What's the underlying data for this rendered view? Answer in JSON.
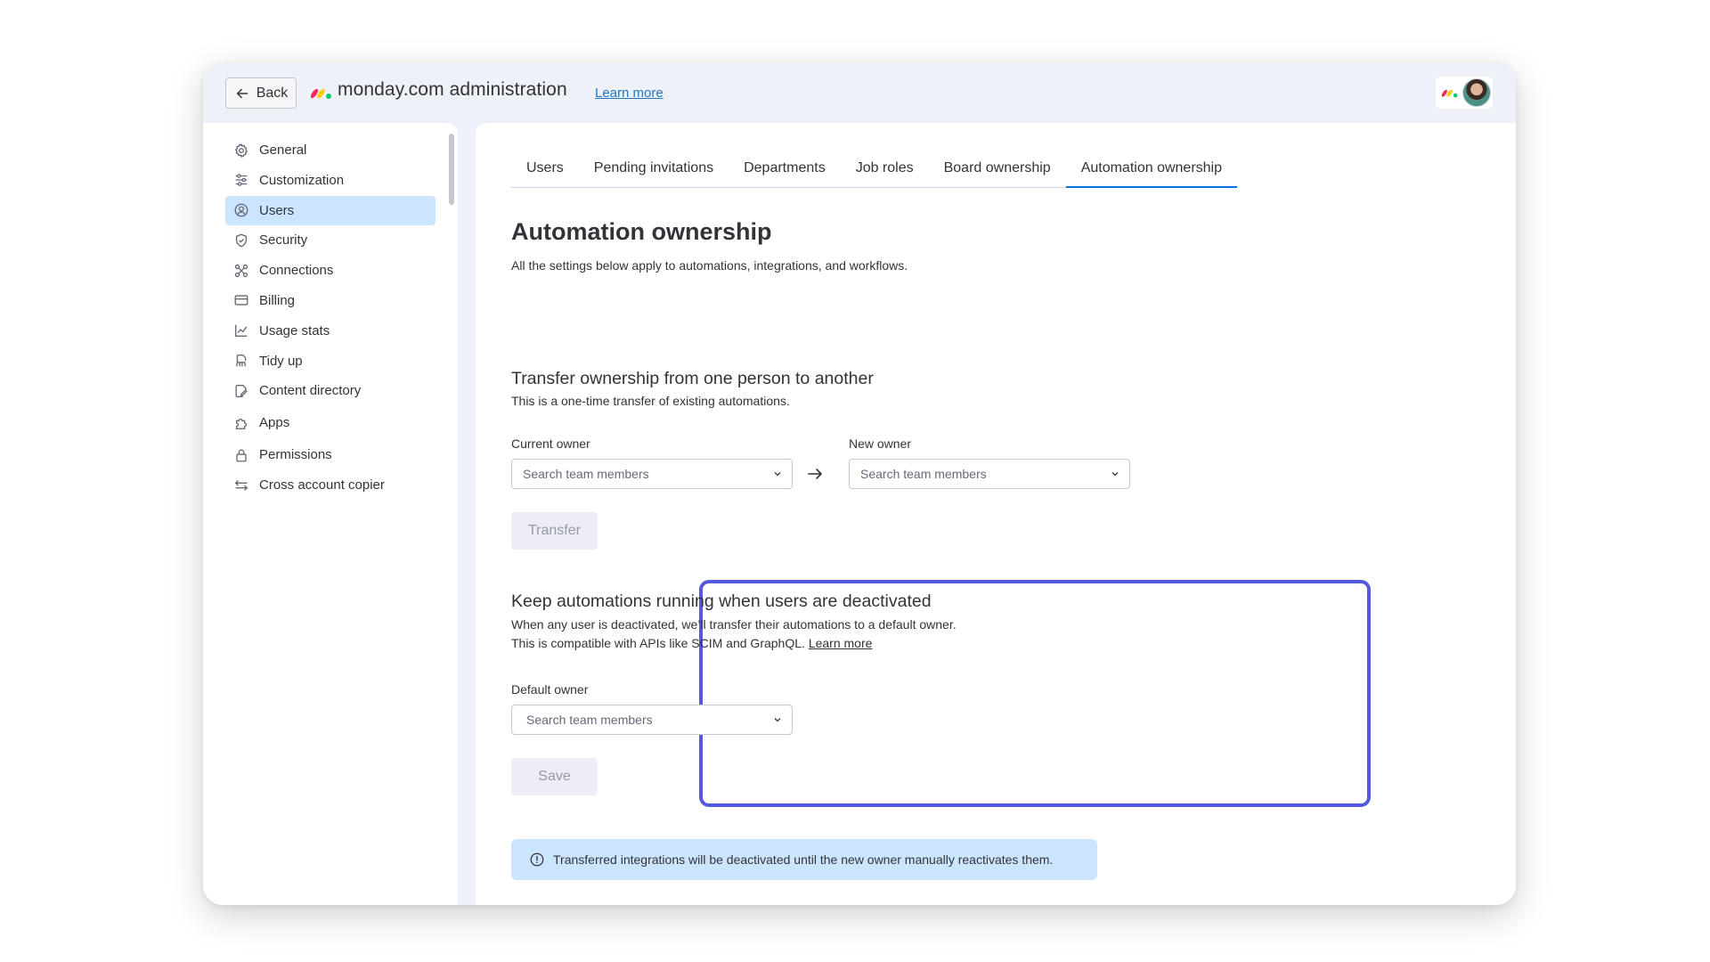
{
  "header": {
    "back_label": "Back",
    "title": "monday.com administration",
    "learn_more": "Learn more"
  },
  "sidebar": {
    "items": [
      {
        "label": "General",
        "icon": "gear-icon"
      },
      {
        "label": "Customization",
        "icon": "sliders-icon"
      },
      {
        "label": "Users",
        "icon": "user-circle-icon",
        "active": true
      },
      {
        "label": "Security",
        "icon": "shield-icon"
      },
      {
        "label": "Connections",
        "icon": "connections-icon"
      },
      {
        "label": "Billing",
        "icon": "credit-card-icon"
      },
      {
        "label": "Usage stats",
        "icon": "chart-line-icon"
      },
      {
        "label": "Tidy up",
        "icon": "broom-icon"
      },
      {
        "label": "Content directory",
        "icon": "document-edit-icon"
      },
      {
        "label": "Apps",
        "icon": "puzzle-icon"
      },
      {
        "label": "Permissions",
        "icon": "lock-icon"
      },
      {
        "label": "Cross account copier",
        "icon": "swap-arrows-icon"
      }
    ]
  },
  "tabs": [
    {
      "label": "Users"
    },
    {
      "label": "Pending invitations"
    },
    {
      "label": "Departments"
    },
    {
      "label": "Job roles"
    },
    {
      "label": "Board ownership"
    },
    {
      "label": "Automation ownership",
      "active": true
    }
  ],
  "page": {
    "title": "Automation ownership",
    "subtitle": "All the settings below apply to automations, integrations, and workflows."
  },
  "transfer": {
    "title": "Transfer ownership from one person to another",
    "desc": "This is a one-time transfer of existing automations.",
    "current_owner_label": "Current owner",
    "current_owner_placeholder": "Search team members",
    "new_owner_label": "New owner",
    "new_owner_placeholder": "Search team members",
    "button": "Transfer"
  },
  "keep_running": {
    "title": "Keep automations running when users are deactivated",
    "desc_line1": "When any user is deactivated, we’ll transfer their automations to a default owner.",
    "desc_line2": "This is compatible with APIs like SCIM and GraphQL.",
    "learn_more": "Learn more",
    "default_owner_label": "Default owner",
    "default_owner_placeholder": "Search team members",
    "button": "Save"
  },
  "info": {
    "text": "Transferred integrations will be deactivated until the new owner manually reactivates them."
  },
  "colors": {
    "accent": "#0073ea",
    "highlight_border": "#5559df",
    "info_bg": "#cce5ff",
    "active_nav_bg": "#cce5ff"
  }
}
